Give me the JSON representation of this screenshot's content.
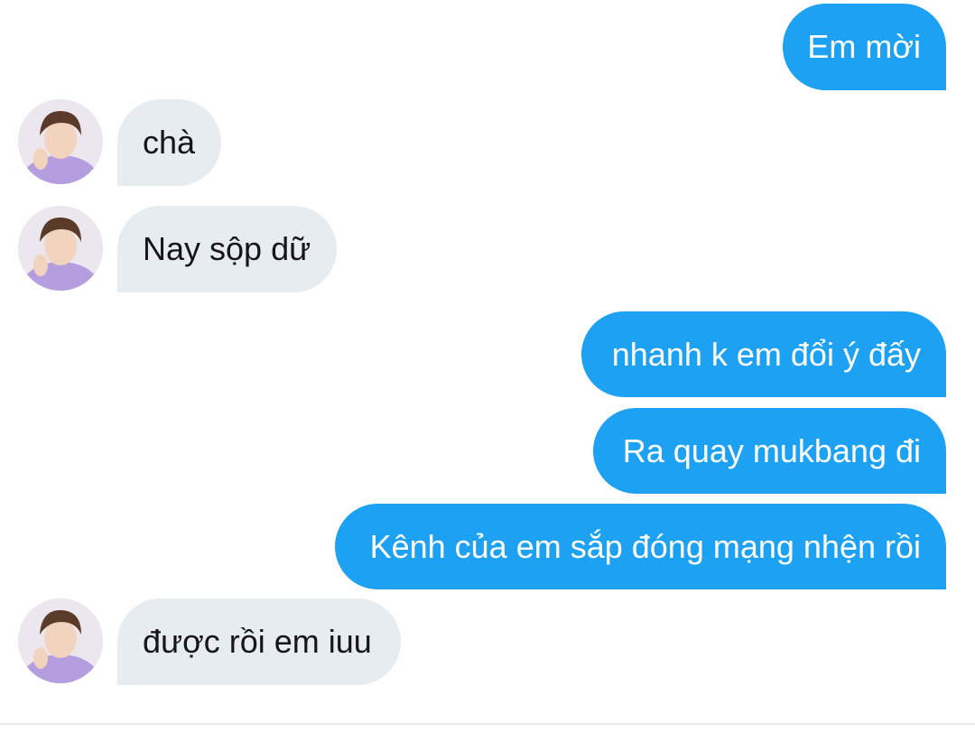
{
  "messages": [
    {
      "from": "me",
      "text": "Em mời"
    },
    {
      "from": "them",
      "text": "chà"
    },
    {
      "from": "them",
      "text": "Nay sộp dữ"
    },
    {
      "from": "me",
      "text": "nhanh k em đổi ý đấy"
    },
    {
      "from": "me",
      "text": "Ra quay mukbang đi"
    },
    {
      "from": "me",
      "text": "Kênh của em sắp đóng mạng nhện rồi"
    },
    {
      "from": "them",
      "text": "được rồi em iuu"
    }
  ],
  "colors": {
    "sent_bubble": "#1da1f2",
    "received_bubble": "#e6ecf0",
    "sent_text": "#ffffff",
    "received_text": "#14171a"
  },
  "icons": {
    "avatar": "user-avatar-photo"
  }
}
